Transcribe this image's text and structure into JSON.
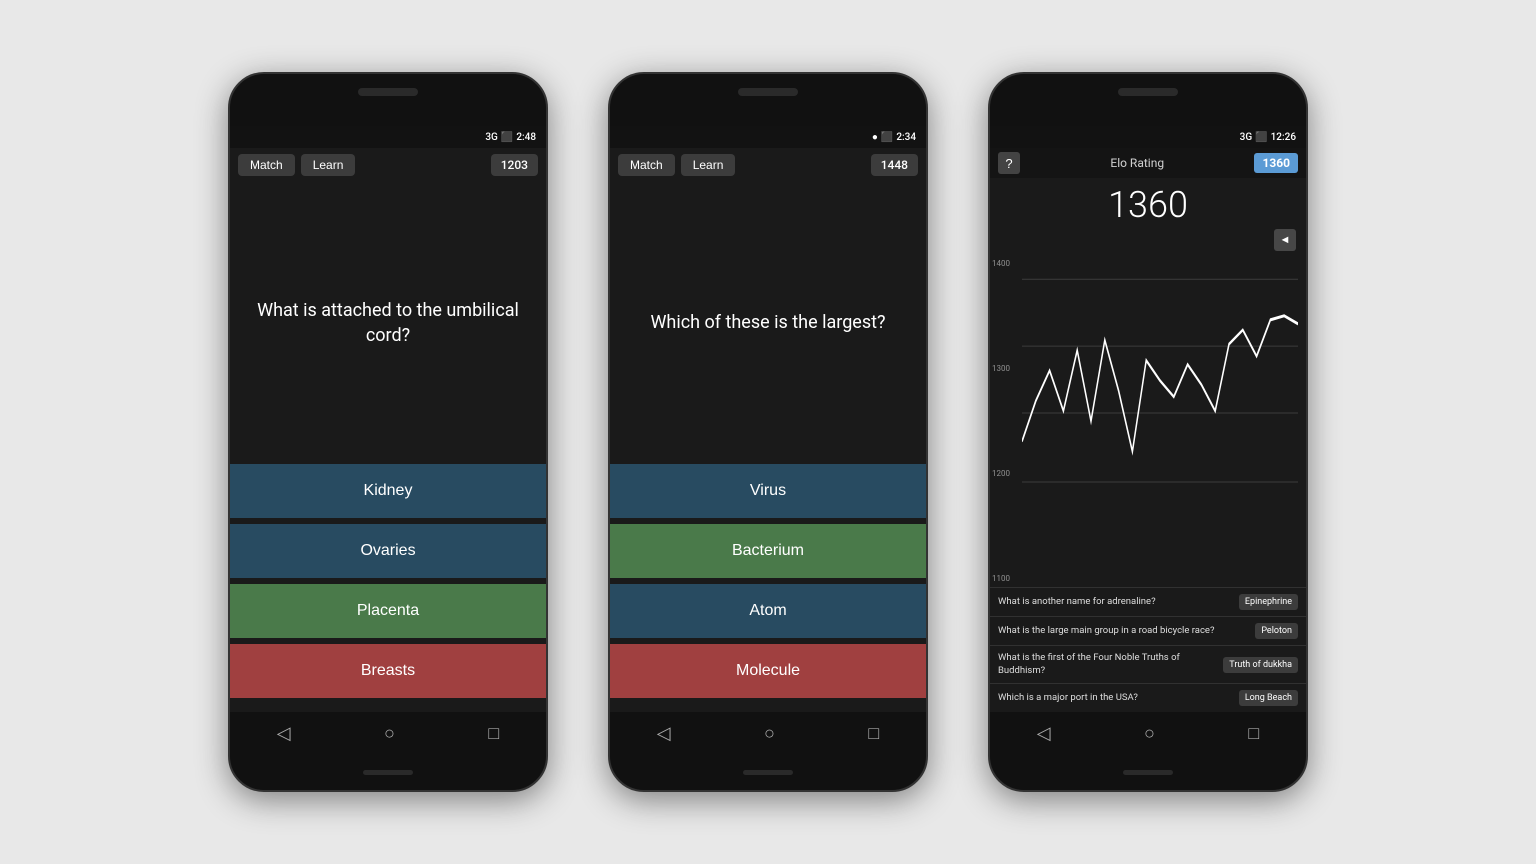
{
  "phone1": {
    "statusBar": {
      "signal": "3G",
      "battery": "▮",
      "time": "2:48"
    },
    "tabs": {
      "match": "Match",
      "learn": "Learn",
      "score": "1203"
    },
    "question": "What is attached to the\numbilical cord?",
    "answers": [
      {
        "text": "Kidney",
        "state": "normal"
      },
      {
        "text": "Ovaries",
        "state": "normal"
      },
      {
        "text": "Placenta",
        "state": "correct"
      },
      {
        "text": "Breasts",
        "state": "wrong"
      }
    ]
  },
  "phone2": {
    "statusBar": {
      "signal": "●",
      "battery": "▮",
      "time": "2:34"
    },
    "tabs": {
      "match": "Match",
      "learn": "Learn",
      "score": "1448"
    },
    "question": "Which of these is the largest?",
    "answers": [
      {
        "text": "Virus",
        "state": "normal"
      },
      {
        "text": "Bacterium",
        "state": "correct"
      },
      {
        "text": "Atom",
        "state": "normal"
      },
      {
        "text": "Molecule",
        "state": "wrong"
      }
    ]
  },
  "phone3": {
    "statusBar": {
      "signal": "3G",
      "battery": "▮",
      "time": "12:26"
    },
    "header": {
      "helpLabel": "?",
      "eloLabel": "Elo Rating",
      "eloBadge": "1360"
    },
    "eloNumber": "1360",
    "soundIcon": "◄",
    "chart": {
      "yLabels": [
        "1400",
        "1300",
        "1200",
        "1100"
      ],
      "points": [
        0,
        40,
        30,
        15,
        50,
        35,
        60,
        42,
        25,
        55,
        48,
        38,
        52,
        44,
        36,
        60,
        65,
        58,
        70,
        72,
        68
      ]
    },
    "qaList": [
      {
        "question": "What is another name for adrenaline?",
        "answer": "Epinephrine"
      },
      {
        "question": "What is the large main group in a road bicycle race?",
        "answer": "Peloton"
      },
      {
        "question": "What is the first of the Four Noble Truths of Buddhism?",
        "answer": "Truth of dukkha"
      },
      {
        "question": "Which is a major port in the USA?",
        "answer": "Long Beach"
      }
    ]
  },
  "bottomNav": {
    "back": "◁",
    "home": "○",
    "recent": "□"
  }
}
